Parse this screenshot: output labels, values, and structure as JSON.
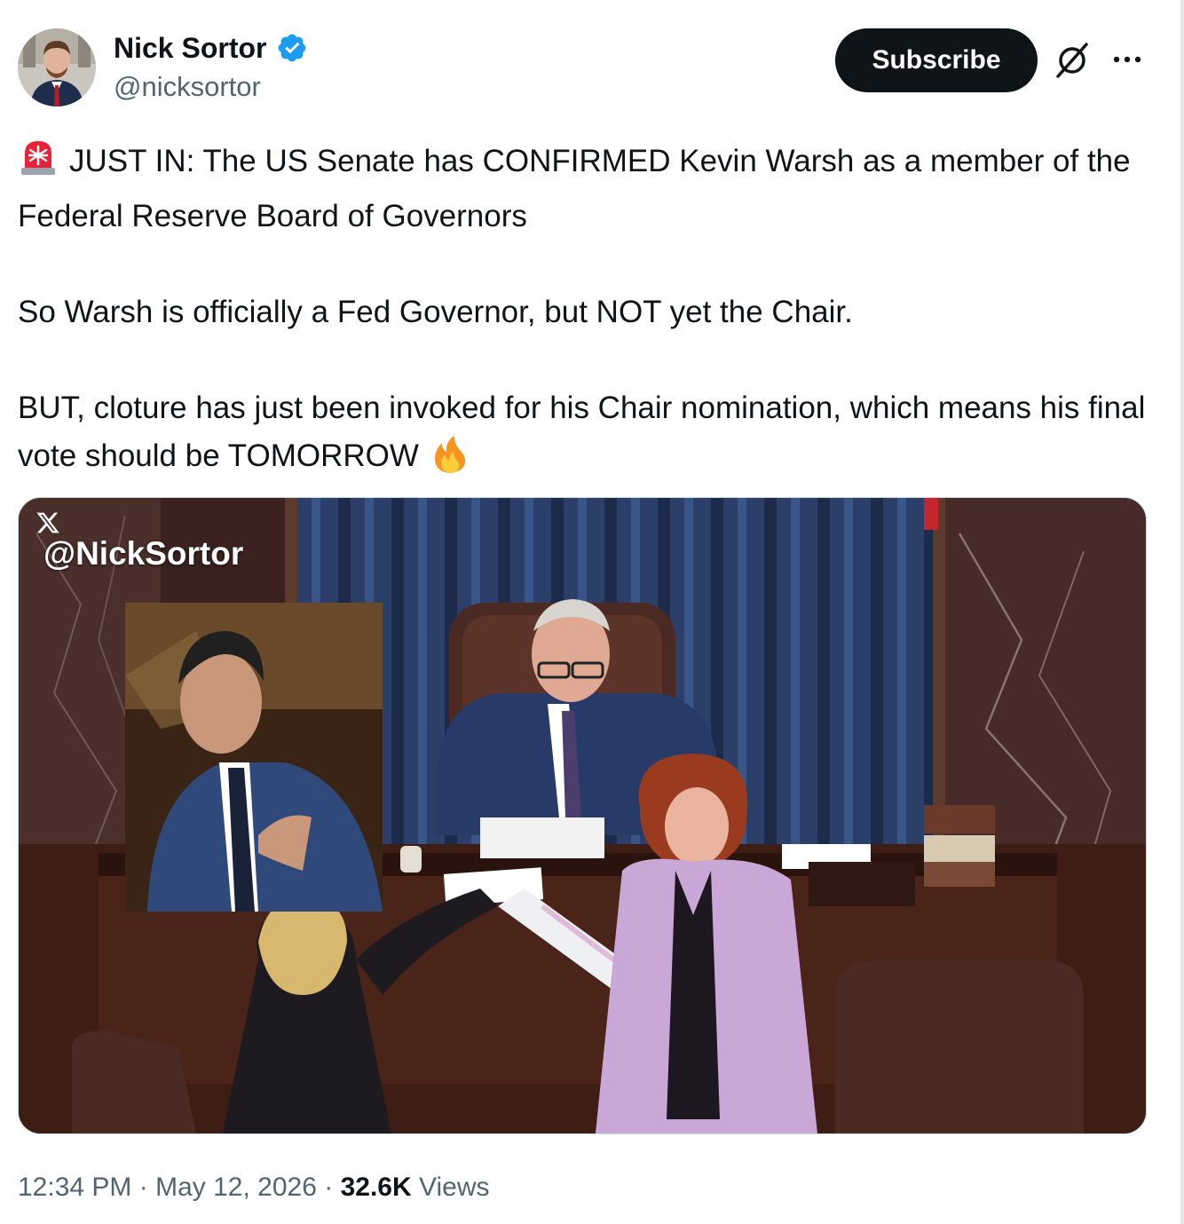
{
  "author": {
    "display_name": "Nick Sortor",
    "handle": "@nicksortor",
    "verified": true,
    "verified_color": "#1d9bf0"
  },
  "actions": {
    "subscribe_label": "Subscribe",
    "grok_icon": "grok-icon",
    "more_icon": "more-icon"
  },
  "tweet": {
    "paragraphs": [
      "JUST IN: The US Senate has CONFIRMED Kevin Warsh as a member of the Federal Reserve Board of Governors",
      "So Warsh is officially a Fed Governor, but NOT yet the Chair.",
      "BUT, cloture has just been invoked for his Chair nomination, which means his final vote should be TOMORROW"
    ],
    "leading_emoji": "rotating-light-icon",
    "trailing_emoji": "fire-icon"
  },
  "media": {
    "watermark_logo": "x-logo-icon",
    "watermark_text": "@NickSortor"
  },
  "meta": {
    "time": "12:34 PM",
    "date": "May 12, 2026",
    "views_count": "32.6K",
    "views_label": "Views",
    "separator": "·"
  }
}
